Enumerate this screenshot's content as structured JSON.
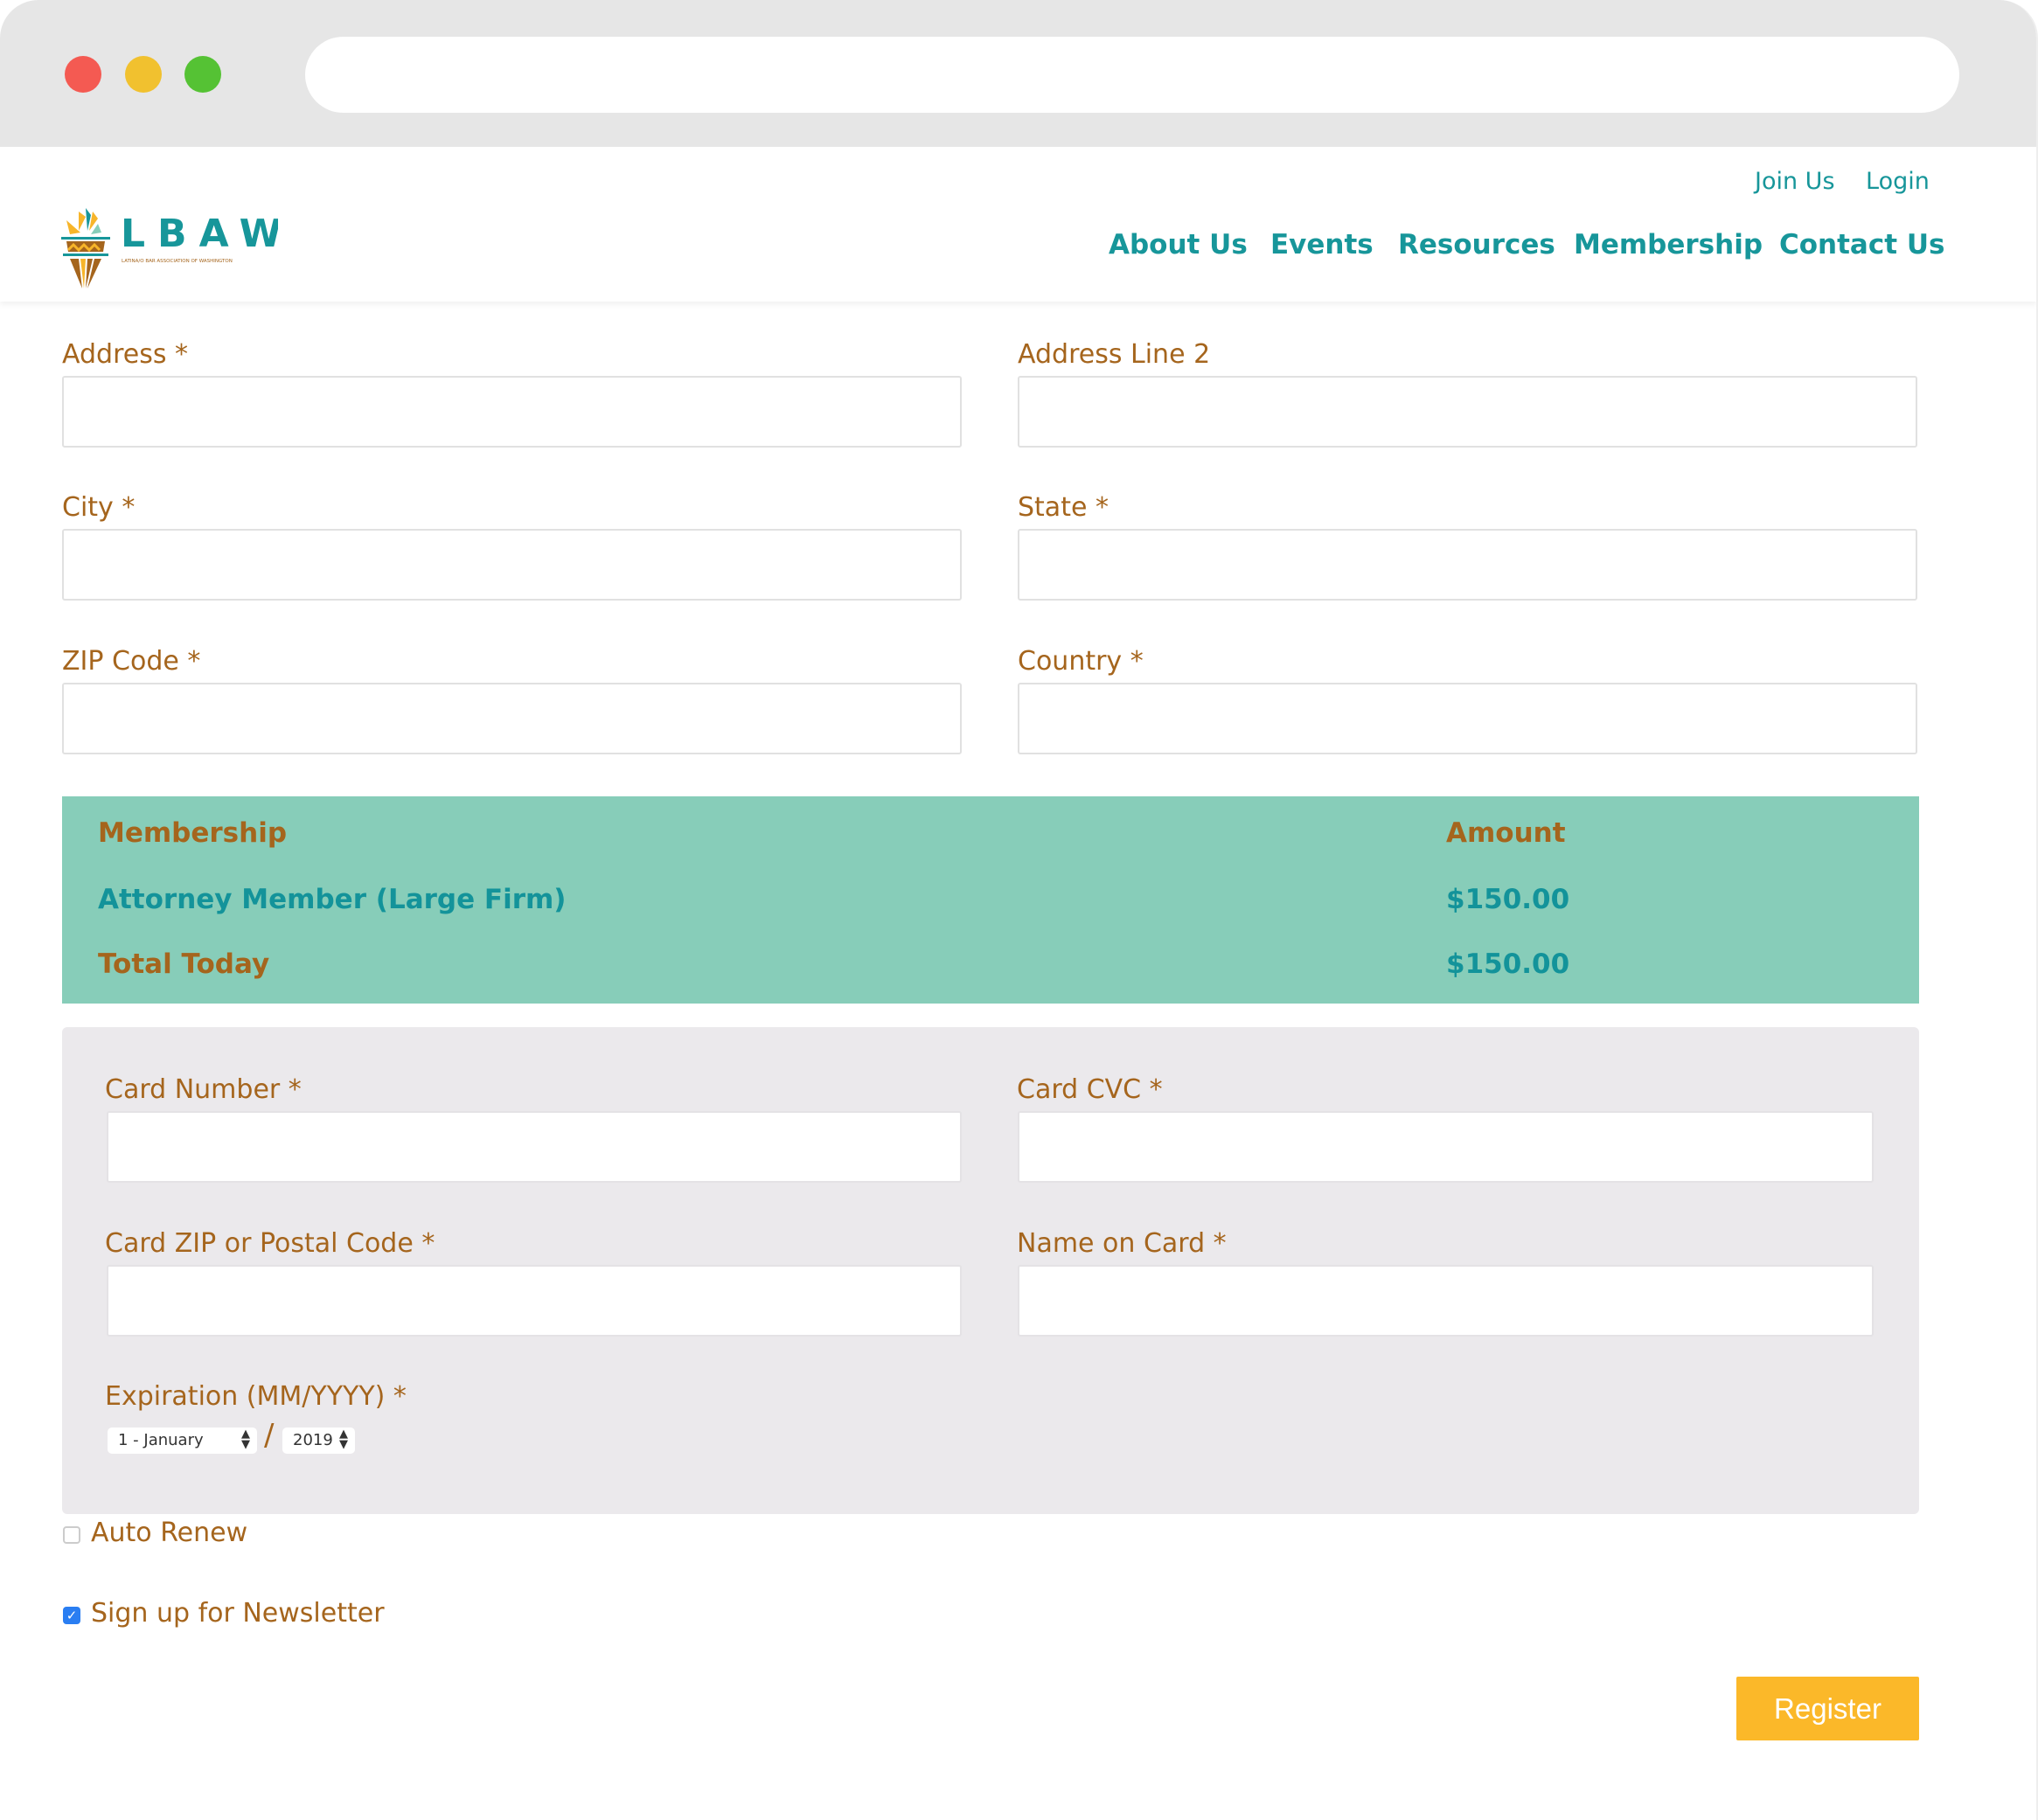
{
  "colors": {
    "brand_teal": "#17969a",
    "label_brown": "#a5651d",
    "table_bg": "#87cdb9",
    "register": "#fbb829"
  },
  "logo": {
    "letters": "LBAW",
    "tagline": "LATINA/O BAR ASSOCIATION OF WASHINGTON"
  },
  "header": {
    "top_links": [
      "Join Us",
      "Login"
    ],
    "nav": [
      "About Us",
      "Events",
      "Resources",
      "Membership",
      "Contact Us"
    ]
  },
  "address_form": {
    "fields": [
      {
        "label": "Address *",
        "value": ""
      },
      {
        "label": "Address Line 2",
        "value": ""
      },
      {
        "label": "City *",
        "value": ""
      },
      {
        "label": "State *",
        "value": ""
      },
      {
        "label": "ZIP Code *",
        "value": ""
      },
      {
        "label": "Country *",
        "value": ""
      }
    ]
  },
  "membership_table": {
    "headers": [
      "Membership",
      "Amount"
    ],
    "rows": [
      {
        "name": "Attorney Member (Large Firm)",
        "amount": "$150.00"
      }
    ],
    "total_label": "Total Today",
    "total_amount": "$150.00"
  },
  "payment": {
    "fields": [
      {
        "label": "Card Number *",
        "value": ""
      },
      {
        "label": "Card CVC *",
        "value": ""
      },
      {
        "label": "Card ZIP or Postal Code *",
        "value": ""
      },
      {
        "label": "Name on Card *",
        "value": ""
      }
    ],
    "expiration_label": "Expiration (MM/YYYY) *",
    "month": "1 - January",
    "separator": "/",
    "year": "2019"
  },
  "options": {
    "auto_renew": {
      "label": "Auto Renew",
      "checked": false
    },
    "newsletter": {
      "label": "Sign up for Newsletter",
      "checked": true
    }
  },
  "register_label": "Register"
}
